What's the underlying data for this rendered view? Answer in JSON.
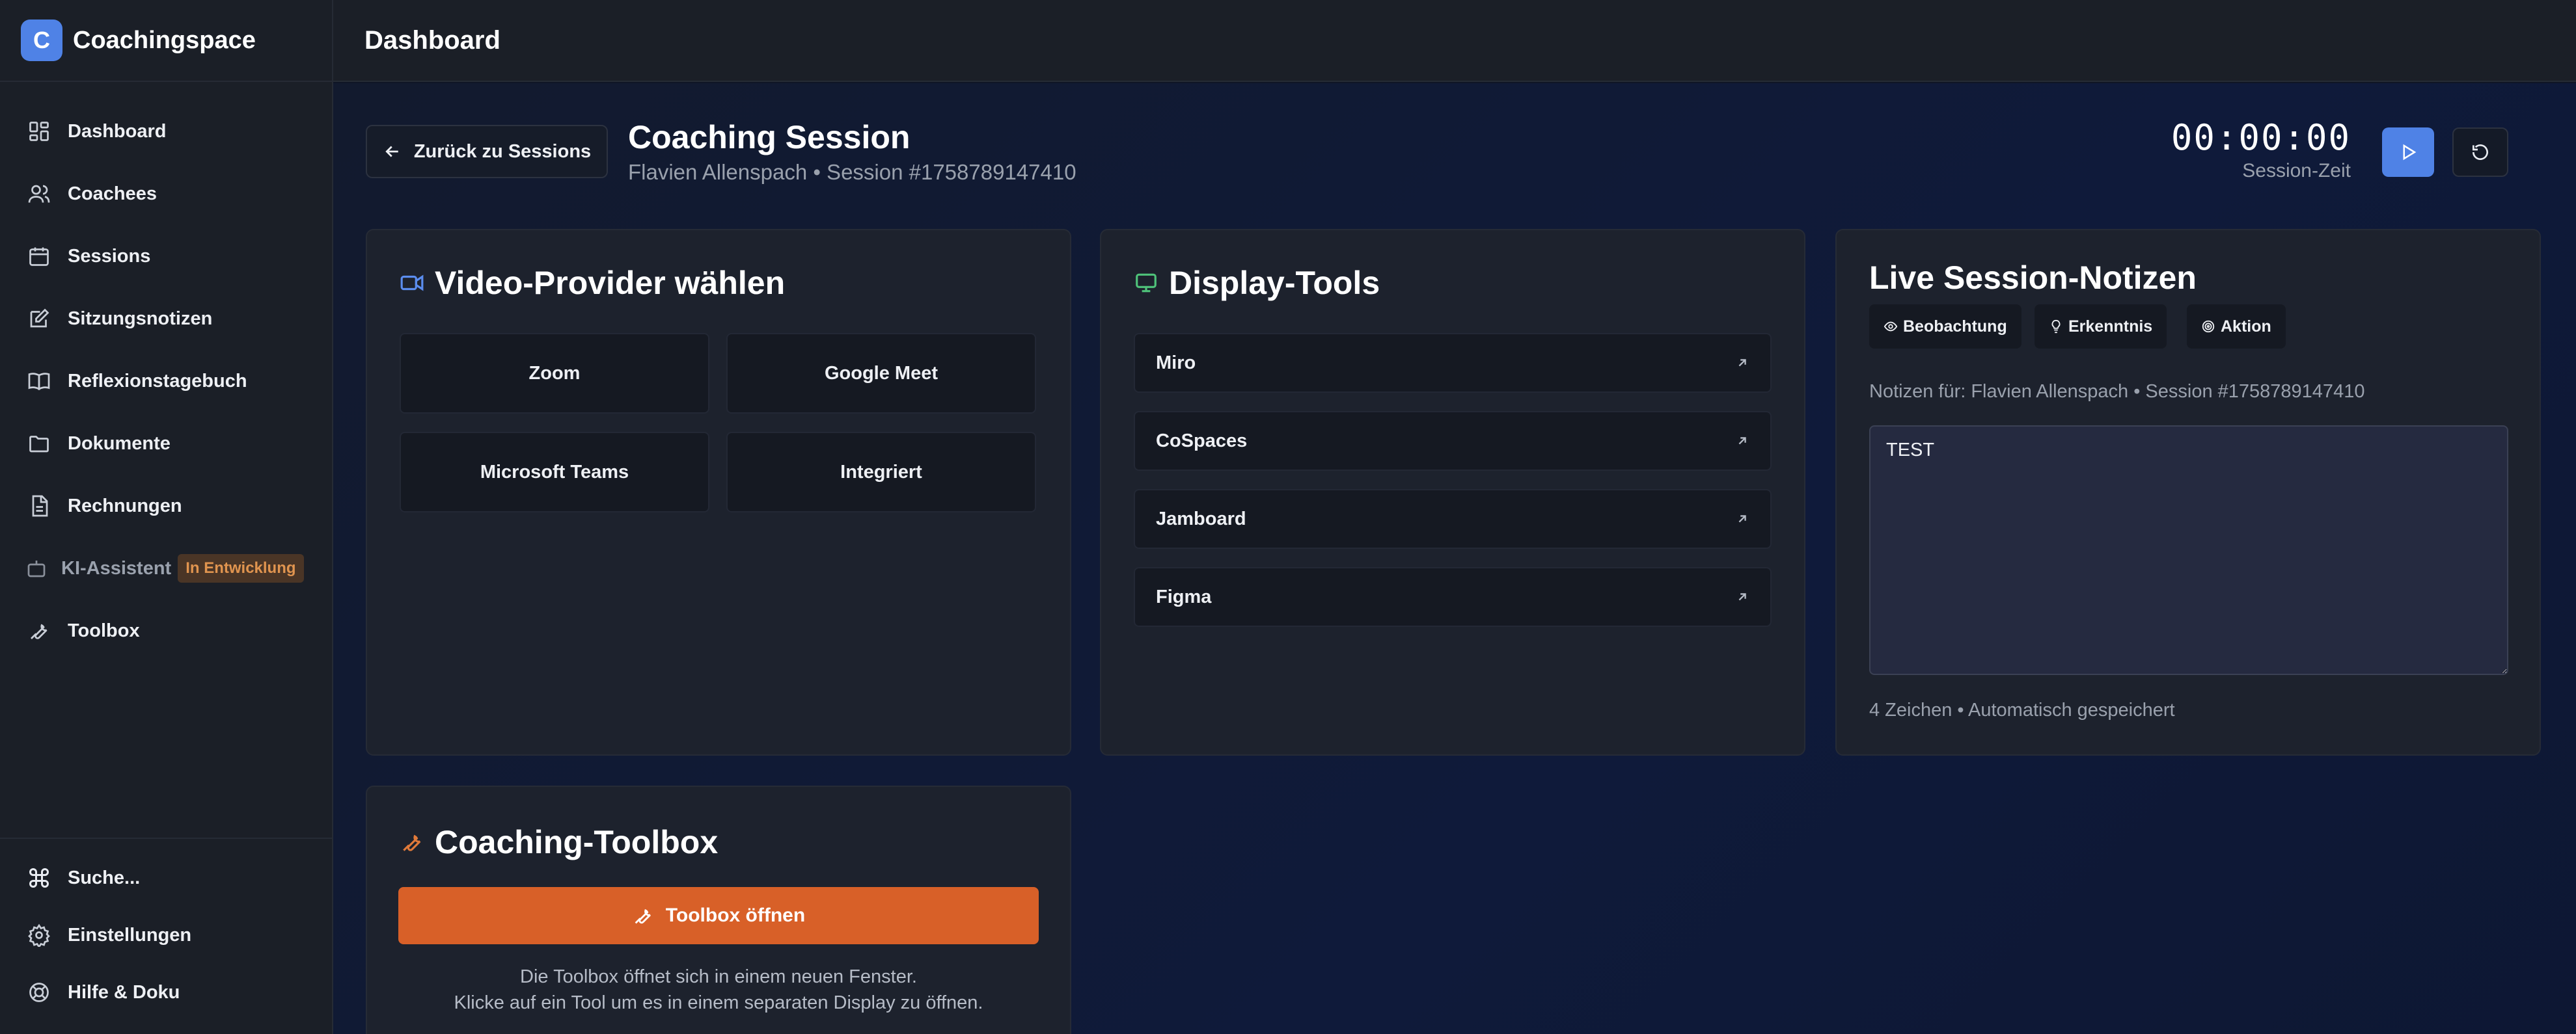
{
  "app": {
    "logo_letter": "C",
    "name": "Coachingspace"
  },
  "header": {
    "title": "Dashboard"
  },
  "sidebar": {
    "items": [
      {
        "label": "Dashboard",
        "icon": "dashboard-icon"
      },
      {
        "label": "Coachees",
        "icon": "users-icon"
      },
      {
        "label": "Sessions",
        "icon": "calendar-icon"
      },
      {
        "label": "Sitzungsnotizen",
        "icon": "edit-note-icon"
      },
      {
        "label": "Reflexionstagebuch",
        "icon": "book-icon"
      },
      {
        "label": "Dokumente",
        "icon": "folder-icon"
      },
      {
        "label": "Rechnungen",
        "icon": "file-text-icon"
      },
      {
        "label": "KI-Assistent",
        "icon": "bot-icon",
        "badge": "In Entwicklung"
      },
      {
        "label": "Toolbox",
        "icon": "wrench-icon"
      }
    ],
    "bottom": [
      {
        "label": "Suche...",
        "icon": "command-icon"
      },
      {
        "label": "Einstellungen",
        "icon": "gear-icon"
      },
      {
        "label": "Hilfe & Doku",
        "icon": "lifebuoy-icon"
      }
    ]
  },
  "session": {
    "back_label": "Zurück zu Sessions",
    "title": "Coaching Session",
    "subtitle": "Flavien Allenspach • Session #1758789147410",
    "timer": "00:00:00",
    "timer_label": "Session-Zeit"
  },
  "video": {
    "title": "Video-Provider wählen",
    "providers": [
      "Zoom",
      "Google Meet",
      "Microsoft Teams",
      "Integriert"
    ]
  },
  "display_tools": {
    "title": "Display-Tools",
    "tools": [
      "Miro",
      "CoSpaces",
      "Jamboard",
      "Figma"
    ]
  },
  "notes": {
    "title": "Live Session-Notizen",
    "tags": [
      "Beobachtung",
      "Erkenntnis",
      "Aktion"
    ],
    "for_label": "Notizen für: Flavien Allenspach • Session #1758789147410",
    "text": "TEST",
    "meta": "4 Zeichen • Automatisch gespeichert"
  },
  "toolbox": {
    "title": "Coaching-Toolbox",
    "button": "Toolbox öffnen",
    "desc_line1": "Die Toolbox öffnet sich in einem neuen Fenster.",
    "desc_line2": "Klicke auf ein Tool um es in einem separaten Display zu öffnen."
  },
  "colors": {
    "accent": "#4f82e6",
    "toolbox": "#d86028",
    "video_icon": "#5b8def",
    "display_icon": "#4fc37a",
    "toolbox_icon": "#e07a3a"
  }
}
